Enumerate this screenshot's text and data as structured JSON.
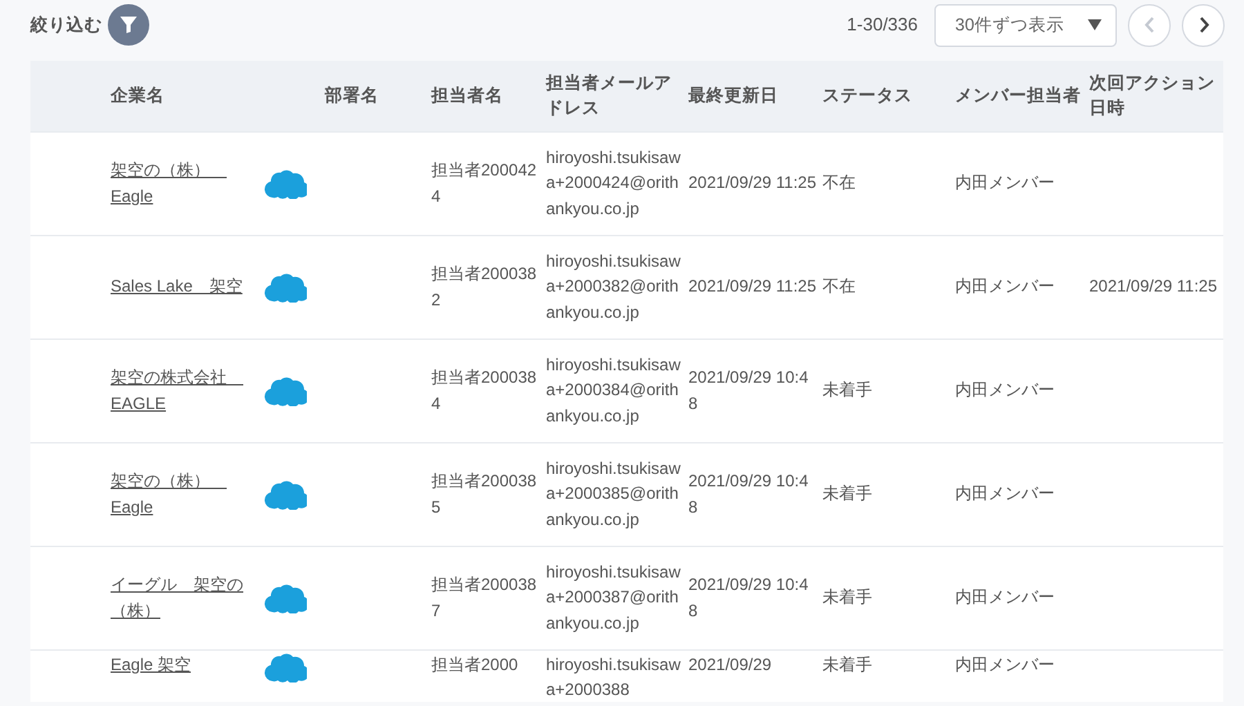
{
  "filter": {
    "label": "絞り込む"
  },
  "pager": {
    "range": "1-30/336",
    "per_page": "30件ずつ表示",
    "prev_disabled": true,
    "next_disabled": false
  },
  "table": {
    "columns": [
      "企業名",
      "部署名",
      "担当者名",
      "担当者メールアドレス",
      "最終更新日",
      "ステータス",
      "メンバー担当者",
      "次回アクション日時"
    ],
    "rows": [
      {
        "company": "架空の（株）　Eagle",
        "department": "",
        "contact": "担当者2000424",
        "email": "hiroyoshi.tsukisawa+2000424@orithankyou.co.jp",
        "updated": "2021/09/29 11:25",
        "status": "不在",
        "member": "内田メンバー",
        "next_action": ""
      },
      {
        "company": "Sales Lake　架空",
        "department": "",
        "contact": "担当者2000382",
        "email": "hiroyoshi.tsukisawa+2000382@orithankyou.co.jp",
        "updated": "2021/09/29 11:25",
        "status": "不在",
        "member": "内田メンバー",
        "next_action": "2021/09/29 11:25"
      },
      {
        "company": "架空の株式会社　EAGLE",
        "department": "",
        "contact": "担当者2000384",
        "email": "hiroyoshi.tsukisawa+2000384@orithankyou.co.jp",
        "updated": "2021/09/29 10:48",
        "status": "未着手",
        "member": "内田メンバー",
        "next_action": ""
      },
      {
        "company": "架空の（株）　Eagle",
        "department": "",
        "contact": "担当者2000385",
        "email": "hiroyoshi.tsukisawa+2000385@orithankyou.co.jp",
        "updated": "2021/09/29 10:48",
        "status": "未着手",
        "member": "内田メンバー",
        "next_action": ""
      },
      {
        "company": "イーグル　架空の（株）",
        "department": "",
        "contact": "担当者2000387",
        "email": "hiroyoshi.tsukisawa+2000387@orithankyou.co.jp",
        "updated": "2021/09/29 10:48",
        "status": "未着手",
        "member": "内田メンバー",
        "next_action": ""
      },
      {
        "company": "Eagle 架空",
        "department": "",
        "contact": "担当者2000",
        "email": "hiroyoshi.tsukisawa+2000388",
        "updated": "2021/09/29",
        "status": "未着手",
        "member": "内田メンバー",
        "next_action": ""
      }
    ]
  }
}
